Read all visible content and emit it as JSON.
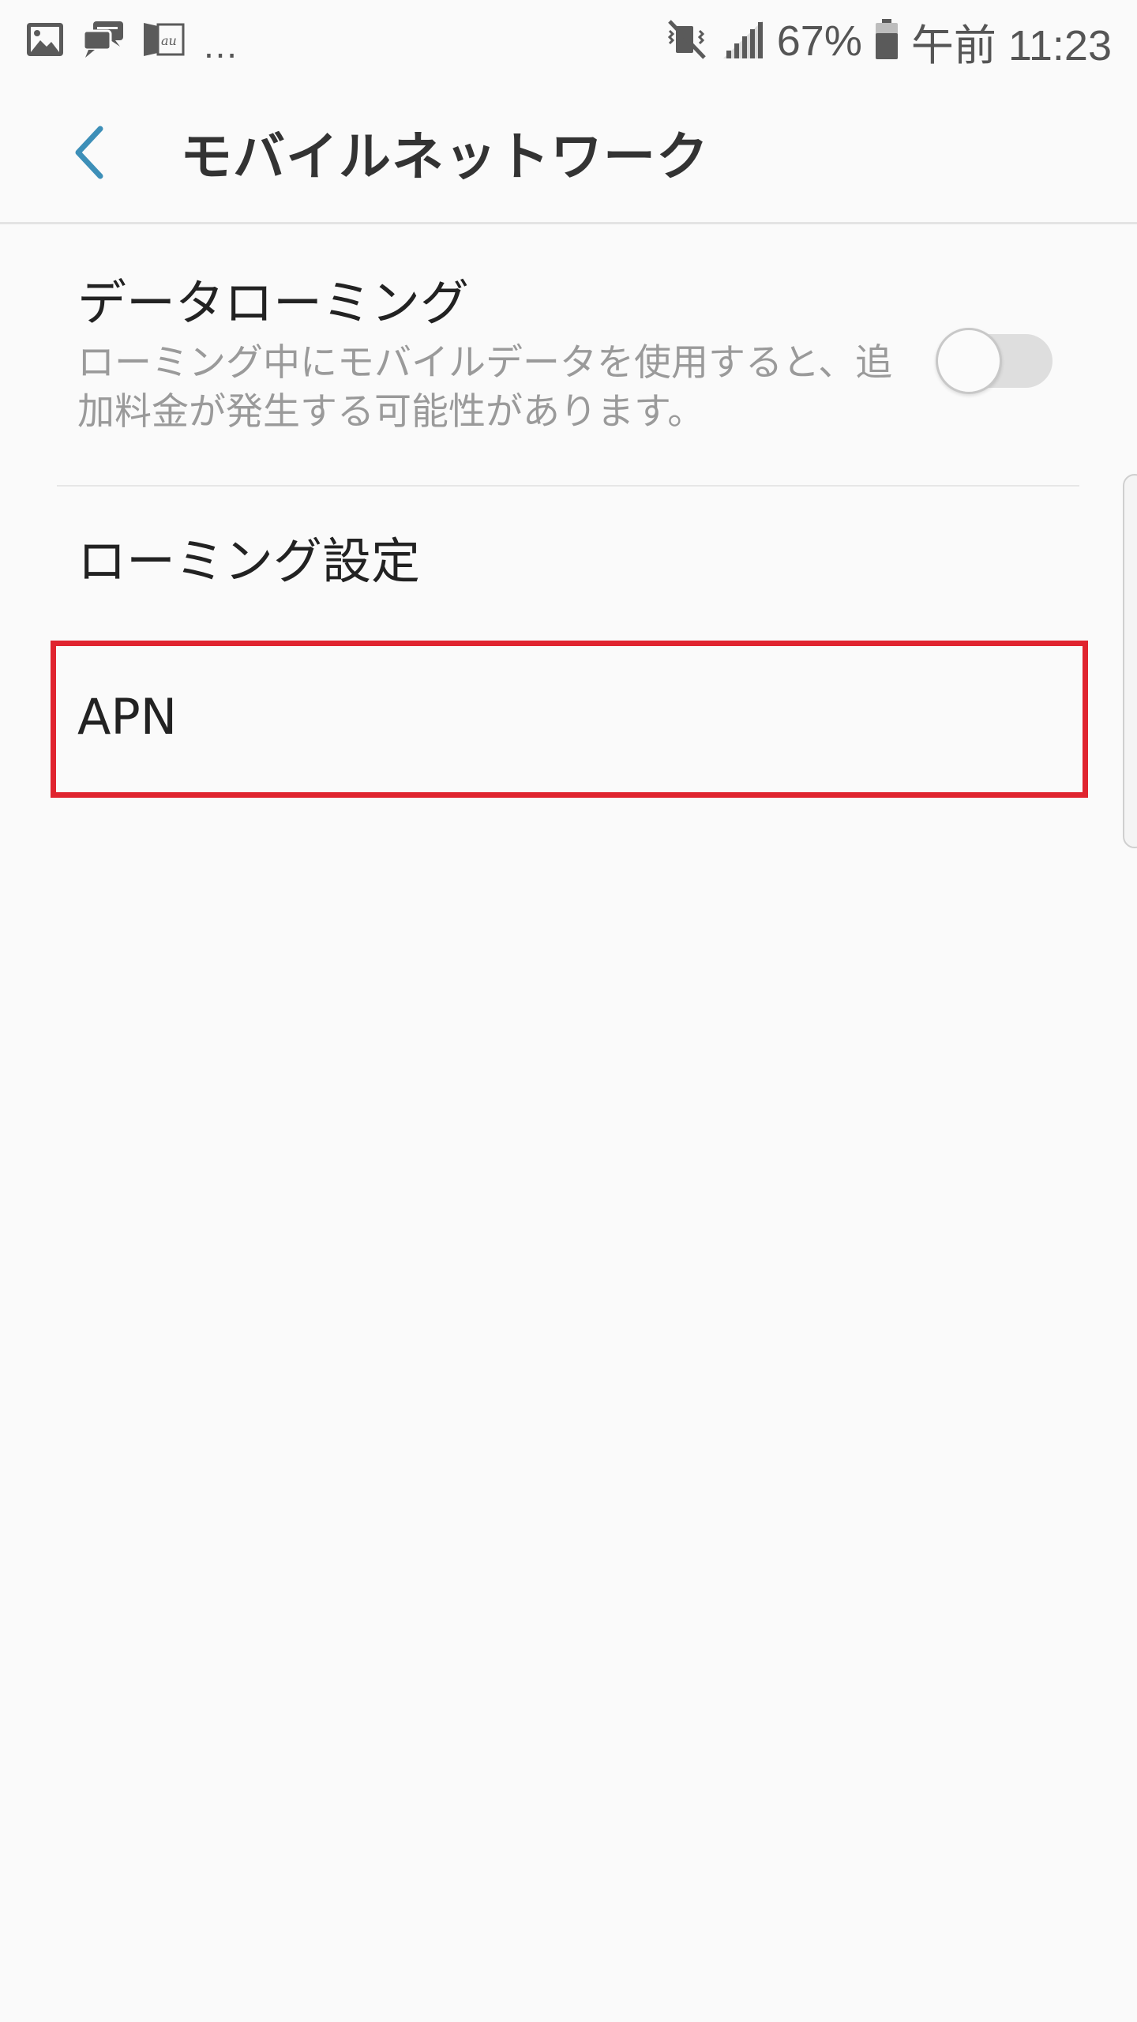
{
  "status_bar": {
    "notification_icons": [
      "gallery-icon",
      "sms-icon",
      "au-app-icon"
    ],
    "more_indicator": "…",
    "battery_percent": "67%",
    "time": "午前 11:23"
  },
  "app_bar": {
    "title": "モバイルネットワーク",
    "accent_color": "#3d8fb8"
  },
  "settings": {
    "data_roaming": {
      "title": "データローミング",
      "description": "ローミング中にモバイルデータを使用すると、追加料金が発生する可能性があります。",
      "toggle_on": false
    },
    "roaming_settings": {
      "title": "ローミング設定"
    },
    "apn": {
      "title": "APN"
    }
  },
  "highlight_color": "#e0242f"
}
